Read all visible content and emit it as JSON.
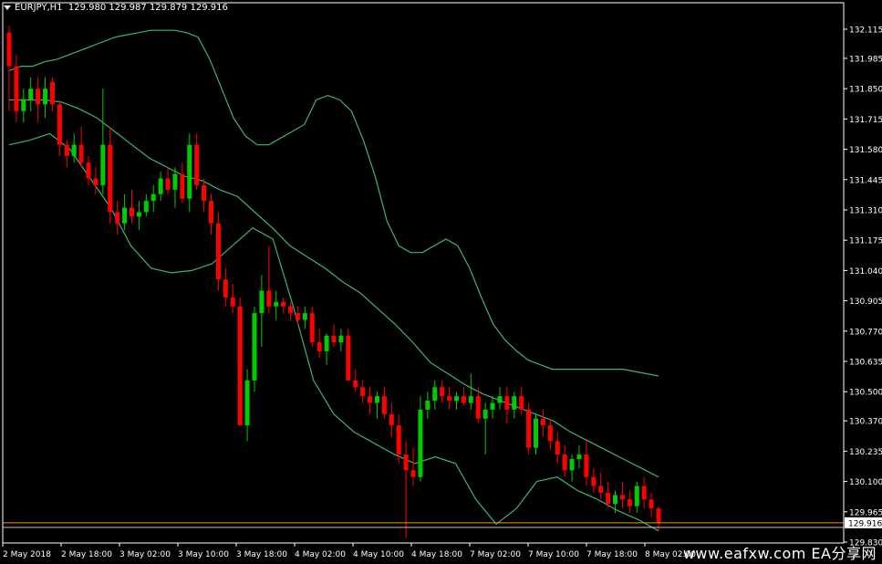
{
  "header": {
    "symbol": "EURJPY,H1",
    "ohlc": "129.980 129.987 129.879 129.916"
  },
  "watermark": "www.eafxw.com  EA分享网",
  "colors": {
    "background": "#000000",
    "bull": "#00cc00",
    "bear": "#ff0000",
    "bands": "#3cb371",
    "price_line": "#ff8c00",
    "grid_text": "#ffffff"
  },
  "chart_data": {
    "type": "candlestick",
    "ylim": [
      129.83,
      132.18
    ],
    "y_ticks": [
      "132.115",
      "131.985",
      "131.850",
      "131.715",
      "131.580",
      "131.445",
      "131.310",
      "131.175",
      "131.040",
      "130.905",
      "130.770",
      "130.635",
      "130.500",
      "130.370",
      "130.235",
      "130.100",
      "129.965",
      "129.830"
    ],
    "x_tick_labels": [
      "2 May 2018",
      "2 May 18:00",
      "3 May 02:00",
      "3 May 10:00",
      "3 May 18:00",
      "4 May 02:00",
      "4 May 10:00",
      "4 May 18:00",
      "7 May 02:00",
      "7 May 10:00",
      "7 May 18:00",
      "8 May 02:00"
    ],
    "current_price": "129.916",
    "candles": [
      [
        132.1,
        132.13,
        131.75,
        131.95
      ],
      [
        131.95,
        132.0,
        131.7,
        131.75
      ],
      [
        131.75,
        131.85,
        131.7,
        131.8
      ],
      [
        131.8,
        131.9,
        131.75,
        131.85
      ],
      [
        131.85,
        131.9,
        131.7,
        131.78
      ],
      [
        131.78,
        131.9,
        131.72,
        131.85
      ],
      [
        131.88,
        131.9,
        131.75,
        131.78
      ],
      [
        131.78,
        131.8,
        131.55,
        131.6
      ],
      [
        131.6,
        131.62,
        131.5,
        131.55
      ],
      [
        131.55,
        131.65,
        131.52,
        131.6
      ],
      [
        131.6,
        131.68,
        131.5,
        131.52
      ],
      [
        131.52,
        131.55,
        131.42,
        131.45
      ],
      [
        131.45,
        131.5,
        131.38,
        131.42
      ],
      [
        131.42,
        131.85,
        131.38,
        131.6
      ],
      [
        131.6,
        131.68,
        131.25,
        131.3
      ],
      [
        131.3,
        131.35,
        131.2,
        131.25
      ],
      [
        131.25,
        131.38,
        131.22,
        131.32
      ],
      [
        131.32,
        131.4,
        131.25,
        131.28
      ],
      [
        131.28,
        131.35,
        131.22,
        131.3
      ],
      [
        131.3,
        131.38,
        131.28,
        131.35
      ],
      [
        131.35,
        131.42,
        131.3,
        131.38
      ],
      [
        131.38,
        131.48,
        131.35,
        131.45
      ],
      [
        131.45,
        131.5,
        131.38,
        131.4
      ],
      [
        131.4,
        131.5,
        131.32,
        131.47
      ],
      [
        131.47,
        131.52,
        131.34,
        131.36
      ],
      [
        131.36,
        131.65,
        131.3,
        131.6
      ],
      [
        131.6,
        131.65,
        131.4,
        131.42
      ],
      [
        131.42,
        131.45,
        131.3,
        131.35
      ],
      [
        131.35,
        131.38,
        131.2,
        131.25
      ],
      [
        131.25,
        131.3,
        130.95,
        131.0
      ],
      [
        131.0,
        131.05,
        130.88,
        130.92
      ],
      [
        130.92,
        130.98,
        130.85,
        130.88
      ],
      [
        130.88,
        130.92,
        130.45,
        130.35
      ],
      [
        130.35,
        130.6,
        130.28,
        130.55
      ],
      [
        130.55,
        130.88,
        130.5,
        130.85
      ],
      [
        130.85,
        131.02,
        130.7,
        130.95
      ],
      [
        130.95,
        131.15,
        130.85,
        130.88
      ],
      [
        130.88,
        130.95,
        130.82,
        130.9
      ],
      [
        130.9,
        130.92,
        130.85,
        130.88
      ],
      [
        130.88,
        130.9,
        130.82,
        130.85
      ],
      [
        130.85,
        130.88,
        130.8,
        130.82
      ],
      [
        130.82,
        130.88,
        130.78,
        130.85
      ],
      [
        130.85,
        130.88,
        130.7,
        130.72
      ],
      [
        130.72,
        130.78,
        130.65,
        130.68
      ],
      [
        130.68,
        130.76,
        130.62,
        130.75
      ],
      [
        130.75,
        130.8,
        130.7,
        130.72
      ],
      [
        130.72,
        130.78,
        130.68,
        130.75
      ],
      [
        130.75,
        130.78,
        130.6,
        130.55
      ],
      [
        130.55,
        130.6,
        130.5,
        130.52
      ],
      [
        130.52,
        130.55,
        130.45,
        130.48
      ],
      [
        130.48,
        130.52,
        130.4,
        130.45
      ],
      [
        130.45,
        130.5,
        130.38,
        130.48
      ],
      [
        130.48,
        130.52,
        130.38,
        130.4
      ],
      [
        130.4,
        130.45,
        130.3,
        130.35
      ],
      [
        130.35,
        130.4,
        130.18,
        130.22
      ],
      [
        130.22,
        130.28,
        129.85,
        130.15
      ],
      [
        130.15,
        130.25,
        130.08,
        130.12
      ],
      [
        130.12,
        130.48,
        130.1,
        130.42
      ],
      [
        130.42,
        130.5,
        130.38,
        130.46
      ],
      [
        130.46,
        130.55,
        130.42,
        130.52
      ],
      [
        130.52,
        130.55,
        130.45,
        130.48
      ],
      [
        130.48,
        130.52,
        130.42,
        130.46
      ],
      [
        130.46,
        130.5,
        130.42,
        130.48
      ],
      [
        130.48,
        130.52,
        130.44,
        130.45
      ],
      [
        130.45,
        130.58,
        130.42,
        130.48
      ],
      [
        130.48,
        130.52,
        130.36,
        130.38
      ],
      [
        130.38,
        130.45,
        130.22,
        130.42
      ],
      [
        130.42,
        130.48,
        130.38,
        130.45
      ],
      [
        130.45,
        130.52,
        130.42,
        130.48
      ],
      [
        130.48,
        130.52,
        130.36,
        130.42
      ],
      [
        130.42,
        130.5,
        130.38,
        130.48
      ],
      [
        130.48,
        130.52,
        130.4,
        130.42
      ],
      [
        130.42,
        130.45,
        130.22,
        130.25
      ],
      [
        130.25,
        130.4,
        130.22,
        130.38
      ],
      [
        130.38,
        130.42,
        130.3,
        130.35
      ],
      [
        130.35,
        130.38,
        130.24,
        130.28
      ],
      [
        130.28,
        130.32,
        130.18,
        130.22
      ],
      [
        130.22,
        130.26,
        130.12,
        130.15
      ],
      [
        130.15,
        130.22,
        130.1,
        130.2
      ],
      [
        130.2,
        130.26,
        130.16,
        130.22
      ],
      [
        130.22,
        130.28,
        130.08,
        130.12
      ],
      [
        130.12,
        130.16,
        130.05,
        130.08
      ],
      [
        130.08,
        130.14,
        130.02,
        130.05
      ],
      [
        130.05,
        130.1,
        129.98,
        130.0
      ],
      [
        130.0,
        130.06,
        129.96,
        130.04
      ],
      [
        130.04,
        130.1,
        129.98,
        130.02
      ],
      [
        130.02,
        130.06,
        129.96,
        129.99
      ],
      [
        129.99,
        130.1,
        129.96,
        130.08
      ],
      [
        130.08,
        130.12,
        129.98,
        130.02
      ],
      [
        130.02,
        130.05,
        129.94,
        129.98
      ],
      [
        129.98,
        129.99,
        129.88,
        129.916
      ]
    ],
    "bands": {
      "upper": [
        131.93,
        131.95,
        131.95,
        131.97,
        131.98,
        132.0,
        132.02,
        132.04,
        132.06,
        132.08,
        132.09,
        132.1,
        132.11,
        132.11,
        132.11,
        132.1,
        132.08,
        131.98,
        131.85,
        131.72,
        131.64,
        131.6,
        131.6,
        131.63,
        131.66,
        131.69,
        131.8,
        131.82,
        131.8,
        131.75,
        131.62,
        131.46,
        131.26,
        131.15,
        131.12,
        131.12,
        131.15,
        131.18,
        131.15,
        131.05,
        130.92,
        130.8,
        130.73,
        130.68,
        130.64,
        130.62,
        130.6,
        130.6,
        130.6,
        130.6,
        130.6,
        130.6,
        130.6,
        130.59,
        130.58,
        130.57
      ],
      "middle": [
        131.8,
        131.8,
        131.8,
        131.79,
        131.76,
        131.72,
        131.66,
        131.6,
        131.54,
        131.5,
        131.46,
        131.44,
        131.4,
        131.37,
        131.3,
        131.23,
        131.15,
        131.1,
        131.05,
        130.99,
        130.94,
        130.87,
        130.8,
        130.72,
        130.63,
        130.58,
        130.53,
        130.49,
        130.46,
        130.43,
        130.4,
        130.37,
        130.32,
        130.28,
        130.24,
        130.2,
        130.16,
        130.12
      ],
      "lower": [
        131.6,
        131.62,
        131.65,
        131.58,
        131.45,
        131.32,
        131.15,
        131.05,
        131.03,
        131.04,
        131.07,
        131.15,
        131.23,
        131.18,
        130.88,
        130.55,
        130.4,
        130.32,
        130.27,
        130.22,
        130.18,
        130.21,
        130.18,
        130.02,
        129.91,
        129.98,
        130.1,
        130.12,
        130.06,
        130.02,
        129.97,
        129.93,
        129.88
      ]
    }
  }
}
